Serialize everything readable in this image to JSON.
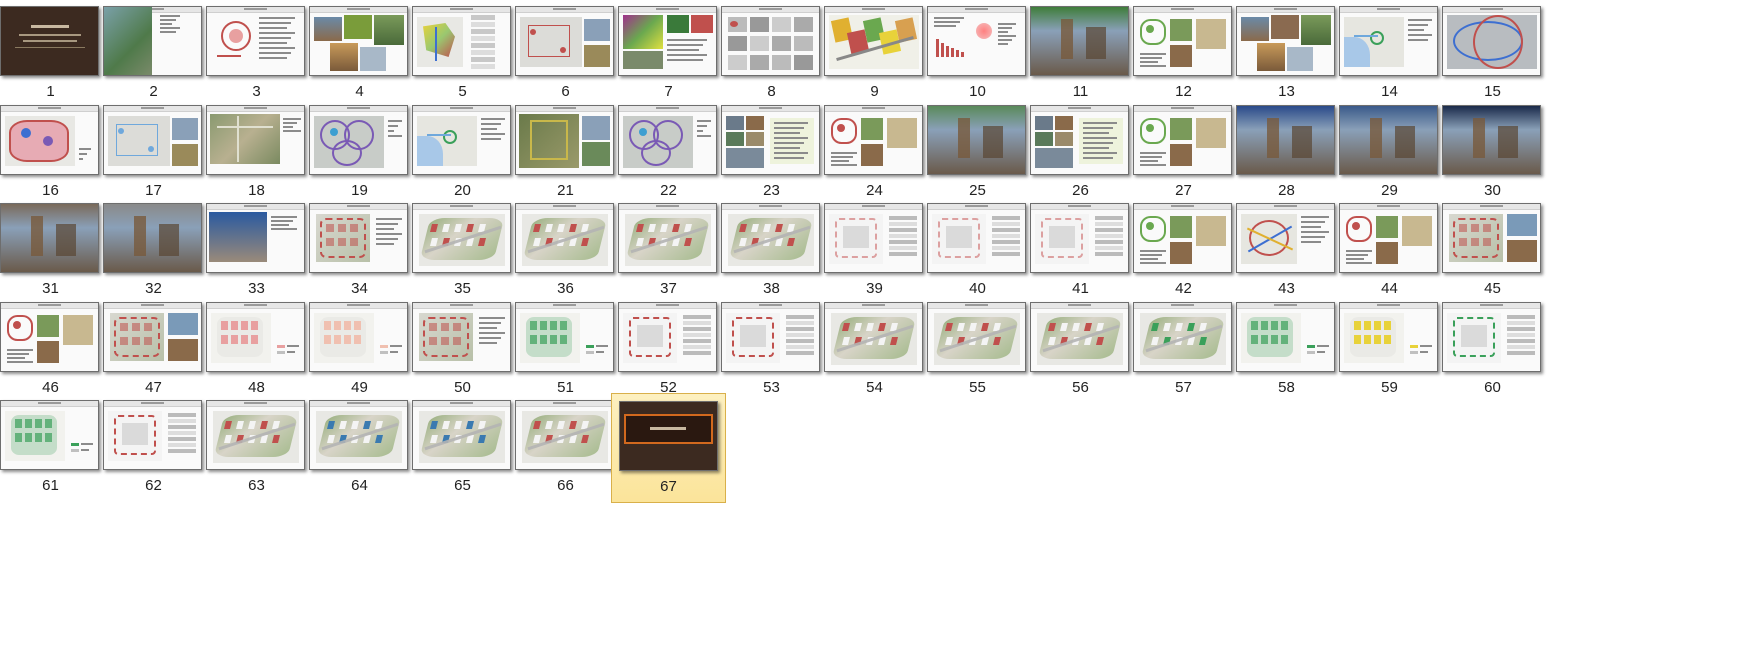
{
  "window": {
    "view": "large-icons",
    "selected_index": 67
  },
  "slides": [
    {
      "label": "1",
      "kind": "cover",
      "bg": "#3c2a20"
    },
    {
      "label": "2",
      "kind": "aerial-text",
      "bg": "#ffffff"
    },
    {
      "label": "3",
      "kind": "diagram-text",
      "accent": "#c0504d"
    },
    {
      "label": "4",
      "kind": "photos",
      "accent": "#7a9c3a"
    },
    {
      "label": "5",
      "kind": "map-table",
      "accent": "#e8d23a"
    },
    {
      "label": "6",
      "kind": "map-photo",
      "accent": "#c0504d"
    },
    {
      "label": "7",
      "kind": "map-photos",
      "accent": "#a0308c"
    },
    {
      "label": "8",
      "kind": "grid-photos",
      "accent": "#9a9a9a"
    },
    {
      "label": "9",
      "kind": "map-color",
      "accent": "#e0b030"
    },
    {
      "label": "10",
      "kind": "chart",
      "accent": "#c0504d"
    },
    {
      "label": "11",
      "kind": "photo",
      "accent": "#3f7d3a"
    },
    {
      "label": "12",
      "kind": "diagram-photos",
      "accent": "#6aa84f"
    },
    {
      "label": "13",
      "kind": "photos",
      "accent": "#8a6a50"
    },
    {
      "label": "14",
      "kind": "map-blue",
      "accent": "#6fa8dc"
    },
    {
      "label": "15",
      "kind": "map-routes",
      "accent": "#3d6fd1"
    },
    {
      "label": "16",
      "kind": "map-red",
      "accent": "#c0504d"
    },
    {
      "label": "17",
      "kind": "map-photo",
      "accent": "#6fa8dc"
    },
    {
      "label": "18",
      "kind": "aerial",
      "accent": "#8a9a70"
    },
    {
      "label": "19",
      "kind": "map-circles",
      "accent": "#7a5ab5"
    },
    {
      "label": "20",
      "kind": "map-blue",
      "accent": "#6fa8dc"
    },
    {
      "label": "21",
      "kind": "aerial-photo",
      "accent": "#c9b84a"
    },
    {
      "label": "22",
      "kind": "map-circles",
      "accent": "#7a5ab5"
    },
    {
      "label": "23",
      "kind": "photos-text",
      "accent": "#8a6a50"
    },
    {
      "label": "24",
      "kind": "diagram-photos",
      "accent": "#c0504d"
    },
    {
      "label": "25",
      "kind": "photo",
      "accent": "#5a8a5a"
    },
    {
      "label": "26",
      "kind": "photos-text",
      "accent": "#b8cc8a"
    },
    {
      "label": "27",
      "kind": "diagram-photos",
      "accent": "#6aa84f"
    },
    {
      "label": "28",
      "kind": "photo",
      "accent": "#2a4a8a"
    },
    {
      "label": "29",
      "kind": "photo",
      "accent": "#3a5a8a"
    },
    {
      "label": "30",
      "kind": "photo",
      "accent": "#1a2a4a"
    },
    {
      "label": "31",
      "kind": "photo",
      "accent": "#7a6a5a"
    },
    {
      "label": "32",
      "kind": "photo",
      "accent": "#8a8a8a"
    },
    {
      "label": "33",
      "kind": "photo-text",
      "accent": "#2a5aa0"
    },
    {
      "label": "34",
      "kind": "plan",
      "accent": "#c0504d"
    },
    {
      "label": "35",
      "kind": "3d",
      "accent": "#c0504d"
    },
    {
      "label": "36",
      "kind": "3d",
      "accent": "#c0504d"
    },
    {
      "label": "37",
      "kind": "3d",
      "accent": "#c0504d"
    },
    {
      "label": "38",
      "kind": "3d",
      "accent": "#c0504d"
    },
    {
      "label": "39",
      "kind": "plan-table",
      "accent": "#dca0a0"
    },
    {
      "label": "40",
      "kind": "plan-table",
      "accent": "#dca0a0"
    },
    {
      "label": "41",
      "kind": "plan-table",
      "accent": "#dca0a0"
    },
    {
      "label": "42",
      "kind": "diagram-photos",
      "accent": "#6aa84f"
    },
    {
      "label": "43",
      "kind": "map-lines",
      "accent": "#c0504d"
    },
    {
      "label": "44",
      "kind": "diagram-photos",
      "accent": "#c0504d"
    },
    {
      "label": "45",
      "kind": "plan-photos",
      "accent": "#c0504d"
    },
    {
      "label": "46",
      "kind": "diagram-photos",
      "accent": "#c0504d"
    },
    {
      "label": "47",
      "kind": "plan-photos",
      "accent": "#c0504d"
    },
    {
      "label": "48",
      "kind": "plan-pink",
      "accent": "#e8a0a0"
    },
    {
      "label": "49",
      "kind": "plan-pink",
      "accent": "#f0c0b0"
    },
    {
      "label": "50",
      "kind": "plan",
      "accent": "#c0504d"
    },
    {
      "label": "51",
      "kind": "plan-green",
      "accent": "#3aa05a"
    },
    {
      "label": "52",
      "kind": "plan-table",
      "accent": "#c0504d"
    },
    {
      "label": "53",
      "kind": "plan-table",
      "accent": "#c0504d"
    },
    {
      "label": "54",
      "kind": "3d",
      "accent": "#c0504d"
    },
    {
      "label": "55",
      "kind": "3d",
      "accent": "#c0504d"
    },
    {
      "label": "56",
      "kind": "3d",
      "accent": "#c0504d"
    },
    {
      "label": "57",
      "kind": "3d",
      "accent": "#3aa05a"
    },
    {
      "label": "58",
      "kind": "plan-green",
      "accent": "#3aa05a"
    },
    {
      "label": "59",
      "kind": "plan-yellow",
      "accent": "#e8d23a"
    },
    {
      "label": "60",
      "kind": "plan-table",
      "accent": "#3aa05a"
    },
    {
      "label": "61",
      "kind": "plan-green",
      "accent": "#3aa05a"
    },
    {
      "label": "62",
      "kind": "plan-table",
      "accent": "#c0504d"
    },
    {
      "label": "63",
      "kind": "3d",
      "accent": "#c0504d"
    },
    {
      "label": "64",
      "kind": "3d",
      "accent": "#3a7ab0"
    },
    {
      "label": "65",
      "kind": "3d",
      "accent": "#3a7ab0"
    },
    {
      "label": "66",
      "kind": "3d",
      "accent": "#c0504d"
    },
    {
      "label": "67",
      "kind": "end",
      "bg": "#3c2a20"
    }
  ]
}
